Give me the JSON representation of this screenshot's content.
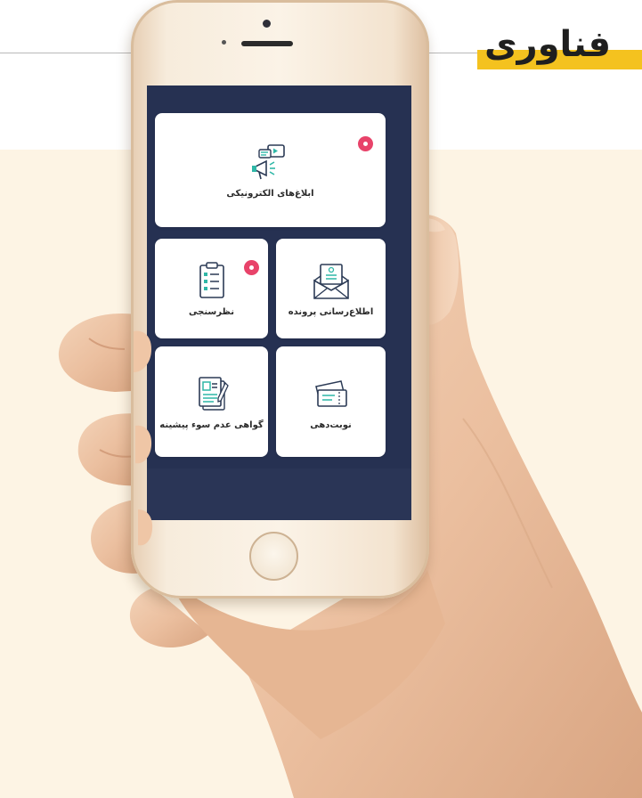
{
  "header": {
    "title": "فناوری",
    "accent_color": "#f4c21f"
  },
  "phone": {
    "screen_color": "#263152",
    "cards": [
      {
        "label": "ابلاغ‌های الکترونیکی",
        "icon": "megaphone-video-icon",
        "badge": true
      },
      {
        "label": "اطلاع‌رسانی پرونده",
        "icon": "envelope-document-icon",
        "badge": false
      },
      {
        "label": "نظرسنجی",
        "icon": "clipboard-survey-icon",
        "badge": true
      },
      {
        "label": "نوبت‌دهی",
        "icon": "tickets-icon",
        "badge": false
      },
      {
        "label": "گواهی عدم سوء پیشینه",
        "icon": "certificate-document-icon",
        "badge": false
      }
    ],
    "badge_color": "#e8436a"
  }
}
